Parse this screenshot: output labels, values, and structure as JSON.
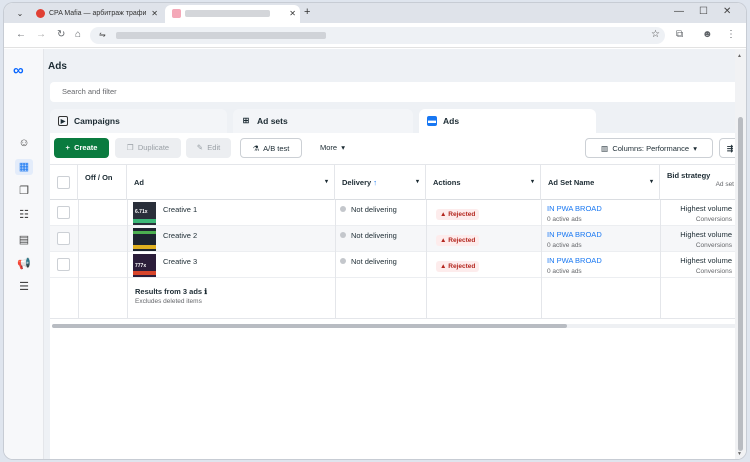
{
  "browser": {
    "tabs": [
      {
        "title": "CPA Mafia — арбитраж трафи"
      },
      {
        "title": ""
      }
    ],
    "icons": {
      "menu": "chevron-down-icon",
      "new_tab": "plus-icon",
      "back": "arrow-left-icon",
      "forward": "arrow-right-icon",
      "reload": "reload-icon",
      "home": "home-icon",
      "site_info": "tune-icon",
      "bookmark": "star-icon",
      "extensions": "puzzle-icon",
      "menu_more": "kebab-icon"
    },
    "glyphs": {
      "menu": "⌄",
      "close": "✕",
      "new_tab": "+",
      "minimize": "—",
      "maximize": "☐",
      "back": "←",
      "forward": "→",
      "reload": "↻",
      "home": "⌂",
      "site_info": "⇋",
      "star": "☆",
      "extensions": "⧉",
      "profile": "☻",
      "kebab": "⋮"
    }
  },
  "sidebar": {
    "logo": "∞",
    "items": [
      {
        "icon": "smiley-icon",
        "glyph": "☺"
      },
      {
        "icon": "table-icon",
        "glyph": "▦",
        "active": true
      },
      {
        "icon": "pages-icon",
        "glyph": "❐"
      },
      {
        "icon": "people-icon",
        "glyph": "☷"
      },
      {
        "icon": "catalog-icon",
        "glyph": "▤"
      },
      {
        "icon": "megaphone-icon",
        "glyph": "📢"
      },
      {
        "icon": "menu-icon",
        "glyph": "☰"
      }
    ]
  },
  "page": {
    "title": "Ads",
    "search_placeholder": "Search and filter",
    "tabs": {
      "campaigns": "Campaigns",
      "adsets": "Ad sets",
      "ads": "Ads"
    },
    "tab_glyphs": {
      "campaigns": "▶",
      "adsets": "⊞",
      "ads": "▬"
    }
  },
  "toolbar": {
    "create": "Create",
    "duplicate": "Duplicate",
    "edit": "Edit",
    "ab_test": "A/B test",
    "more": "More",
    "columns": "Columns: Performance",
    "glyphs": {
      "create": "+",
      "duplicate": "❐",
      "edit": "✎",
      "ab_test": "⚗",
      "more": "▾",
      "columns": "▥",
      "columns_caret": "▾",
      "extra": "⇶"
    }
  },
  "table": {
    "headers": {
      "offon": "Off / On",
      "ad": "Ad",
      "delivery": "Delivery",
      "delivery_sort": "↑",
      "actions": "Actions",
      "adset": "Ad Set Name",
      "bid": "Bid strategy",
      "bid_sub": "Ad set",
      "caret": "▾"
    },
    "rows": [
      {
        "name": "Creative 1",
        "delivery": "Not delivering",
        "action": "Rejected",
        "adset": "IN PWA BROAD",
        "adset_sub": "0 active ads",
        "bid": "Highest volume",
        "bid_sub": "Conversions",
        "thumb_text": "6.71x"
      },
      {
        "name": "Creative 2",
        "delivery": "Not delivering",
        "action": "Rejected",
        "adset": "IN PWA BROAD",
        "adset_sub": "0 active ads",
        "bid": "Highest volume",
        "bid_sub": "Conversions",
        "thumb_text": ""
      },
      {
        "name": "Creative 3",
        "delivery": "Not delivering",
        "action": "Rejected",
        "adset": "IN PWA BROAD",
        "adset_sub": "0 active ads",
        "bid": "Highest volume",
        "bid_sub": "Conversions",
        "thumb_text": "777x"
      }
    ],
    "action_glyph": "▲",
    "results": "Results from 3 ads",
    "results_info_glyph": "ℹ",
    "results_sub": "Excludes deleted items"
  },
  "colors": {
    "accent": "#1877f2",
    "create_button": "#0a7b3f",
    "rejected": "#b3261e",
    "meta_blue": "#0866ff"
  }
}
